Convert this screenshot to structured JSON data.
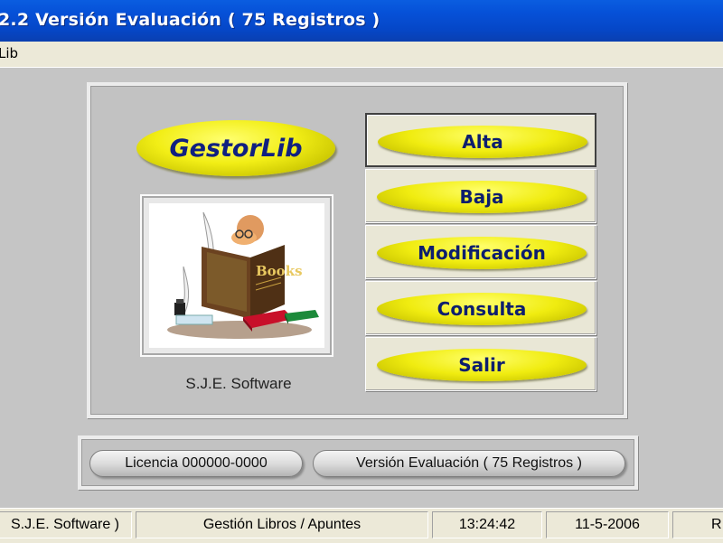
{
  "window": {
    "title": "2.2  Versión Evaluación ( 75 Registros )"
  },
  "menubar": {
    "items": [
      "Lib"
    ]
  },
  "logo": {
    "text": "GestorLib"
  },
  "picture": {
    "book_cover_text": "Books"
  },
  "company_label": "S.J.E. Software",
  "menu_buttons": [
    {
      "label": "Alta",
      "active": true
    },
    {
      "label": "Baja",
      "active": false
    },
    {
      "label": "Modificación",
      "active": false
    },
    {
      "label": "Consulta",
      "active": false
    },
    {
      "label": "Salir",
      "active": false
    }
  ],
  "bottom_buttons": {
    "license": "Licencia 000000-0000",
    "version": "Versión Evaluación ( 75 Registros )"
  },
  "statusbar": {
    "cells": [
      "S.J.E. Software )",
      "Gestión Libros / Apuntes",
      "13:24:42",
      "11-5-2006",
      "R"
    ]
  },
  "colors": {
    "titlebar": "#0551d8",
    "pill_yellow": "#f0ec10",
    "pill_text": "#0d1e6e"
  }
}
